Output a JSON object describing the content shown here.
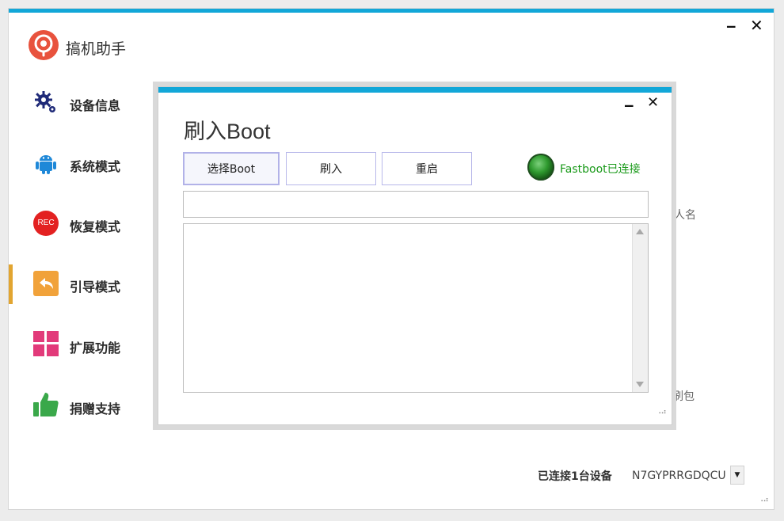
{
  "app": {
    "title": "搞机助手",
    "minimize": "‒",
    "close": "✕"
  },
  "sidebar": {
    "items": [
      {
        "label": "设备信息",
        "icon": "gear-icon"
      },
      {
        "label": "系统模式",
        "icon": "android-icon"
      },
      {
        "label": "恢复模式",
        "icon": "rec-icon",
        "icon_text": "REC"
      },
      {
        "label": "引导模式",
        "icon": "back-arrow-icon",
        "active": true
      },
      {
        "label": "扩展功能",
        "icon": "grid-icon"
      },
      {
        "label": "捐赠支持",
        "icon": "thumbs-up-icon"
      }
    ]
  },
  "background": {
    "partial_label_1": "人名",
    "partial_label_2": "刷包"
  },
  "statusbar": {
    "connected_text": "已连接1台设备",
    "device_serial": "N7GYPRRGDQCU",
    "dropdown_arrow": "▼"
  },
  "dialog": {
    "title": "刷入Boot",
    "minimize": "‒",
    "close": "✕",
    "buttons": {
      "select_boot": "选择Boot",
      "flash": "刷入",
      "reboot": "重启"
    },
    "connection_status": "Fastboot已连接",
    "path_value": "",
    "log_text": ""
  },
  "colors": {
    "accent_topbar": "#12a7d8",
    "active_nav": "#e2a531",
    "status_green": "#1a9a1a",
    "button_border": "#b8b8ea"
  }
}
